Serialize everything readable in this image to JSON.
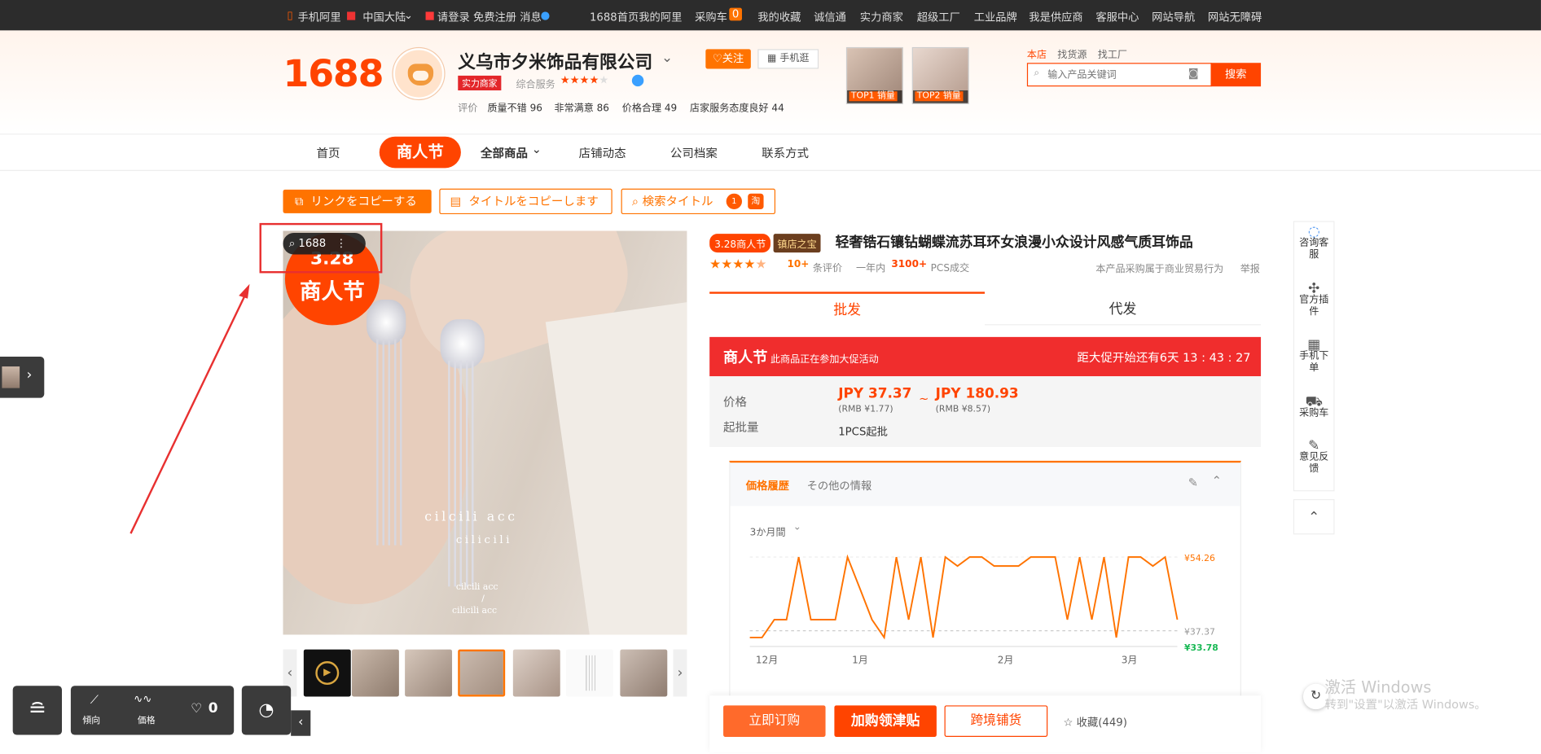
{
  "topbar": {
    "mobile": "手机阿里",
    "region": "中国大陆",
    "login": "请登录 免费注册 消息",
    "links": [
      "1688首页",
      "我的阿里",
      "采购车",
      "我的收藏",
      "诚信通",
      "实力商家",
      "超级工厂",
      "工业品牌",
      "我是供应商",
      "客服中心",
      "网站导航",
      "网站无障碍"
    ],
    "cart_count": "0"
  },
  "header": {
    "logo": "1688",
    "company": "义乌市夕米饰品有限公司",
    "badge": "实力商家",
    "service_label": "综合服务",
    "rating_label": "评价",
    "ratings": [
      "质量不错 96",
      "非常满意 86",
      "价格合理 49",
      "店家服务态度良好 44"
    ],
    "follow": "关注",
    "mobile_shop": "手机逛",
    "top1": "TOP1 销量",
    "top2": "TOP2 销量",
    "search_tabs": [
      "本店",
      "找货源",
      "找工厂"
    ],
    "search_placeholder": "输入产品关键词",
    "search_button": "搜索"
  },
  "nav": {
    "items": [
      "首页",
      "商人节",
      "全部商品",
      "店铺动态",
      "公司档案",
      "联系方式"
    ]
  },
  "plugin": {
    "copy_link": "リンクをコピーする",
    "copy_title": "タイトルをコピーします",
    "search_title": "検索タイトル",
    "tao": "淘",
    "badge1688": "1688"
  },
  "promo_img": {
    "date": "3.28",
    "name": "商人节",
    "text1": "cilcili acc",
    "text2": "cilicili",
    "text3": "cilcili acc",
    "text4": "/",
    "text5": "cilicili acc"
  },
  "product": {
    "tag1": "3.28商人节",
    "tag2": "镇店之宝",
    "title": "轻奢锆石镶钻蝴蝶流苏耳环女浪漫小众设计风感气质耳饰品",
    "reviews_count": "10+",
    "reviews_label": "条评价",
    "year_label": "一年内",
    "sales": "3100+",
    "sales_unit": "PCS成交",
    "note": "本产品采购属于商业贸易行为",
    "report": "举报"
  },
  "tabs": {
    "wholesale": "批发",
    "dropship": "代发"
  },
  "promo": {
    "name": "商人节",
    "desc": "此商品正在参加大促活动",
    "countdown": "距大促开始还有6天 13 : 43 : 27"
  },
  "price": {
    "label": "价格",
    "low": "JPY 37.37",
    "low_rmb": "(RMB ¥1.77)",
    "sep": "~",
    "high": "JPY 180.93",
    "high_rmb": "(RMB ¥8.57)",
    "moq_label": "起批量",
    "moq": "1PCS起批"
  },
  "history": {
    "tab1": "価格履歴",
    "tab2": "その他の情報",
    "range": "3か月間",
    "xlabels": [
      "12月",
      "1月",
      "2月",
      "3月"
    ],
    "ymax": "¥54.26",
    "ymid": "¥37.37",
    "ymin": "¥33.78"
  },
  "actions": {
    "buy": "立即订购",
    "cart": "加购领津贴",
    "cross": "跨境铺货",
    "fav": "收藏(449)"
  },
  "side": {
    "items": [
      "咨询客服",
      "官方插件",
      "手机下单",
      "采购车",
      "意见反馈"
    ]
  },
  "bottom": {
    "trend": "傾向",
    "price": "価格",
    "likes": "0"
  },
  "windows": {
    "title": "激活 Windows",
    "sub": "转到\"设置\"以激活 Windows。"
  },
  "chart_data": {
    "type": "line",
    "x_labels": [
      "12月",
      "1月",
      "2月",
      "3月"
    ],
    "y_labels": [
      "¥54.26",
      "¥37.37",
      "¥33.78"
    ],
    "values": [
      36,
      36,
      40,
      40,
      54,
      40,
      40,
      40,
      54,
      47,
      40,
      36,
      54,
      40,
      54,
      36,
      54,
      52,
      54,
      54,
      52,
      52,
      52,
      54,
      54,
      54,
      40,
      54,
      40,
      54,
      36,
      54,
      54,
      52,
      54,
      40
    ]
  }
}
